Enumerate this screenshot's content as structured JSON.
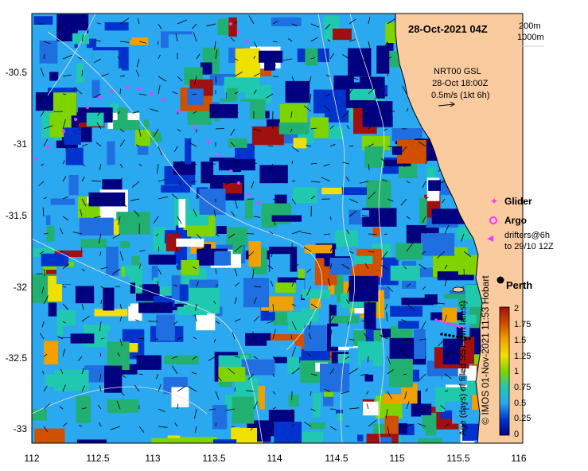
{
  "map": {
    "title": "28-Oct-2021 04Z",
    "depth_contours": [
      "200m",
      "1000m"
    ],
    "current_source": "NRT00 GSL",
    "current_time": "28-Oct 18:00Z",
    "current_scale": "0.5m/s (1kt 6h)",
    "city_label": "Perth",
    "y_ticks": [
      "-30.5",
      "-31",
      "-31.5",
      "-32",
      "-32.5",
      "-33"
    ],
    "x_ticks": [
      "112",
      "112.5",
      "113",
      "113.5",
      "114",
      "114.5",
      "115",
      "115.5",
      "116"
    ],
    "legend": {
      "glider": "Glider",
      "argo": "Argo",
      "drifters_line1": "drifters@6h",
      "drifters_line2": "to 29/10 12Z"
    },
    "colorbar": {
      "title": "Age (days) of filled SST (wrt latest)",
      "ticks": [
        "2",
        "1.75",
        "1.5",
        "1.25",
        "1",
        "0.75",
        "0.5",
        "0.25",
        "0"
      ]
    },
    "credit": "© IMOS 01-Nov-2021 11:53 Hobart"
  },
  "colors": {
    "land": "#FACB9E",
    "glider": "#FF33FF",
    "argo": "#FF33FF",
    "coast": "#000000"
  }
}
